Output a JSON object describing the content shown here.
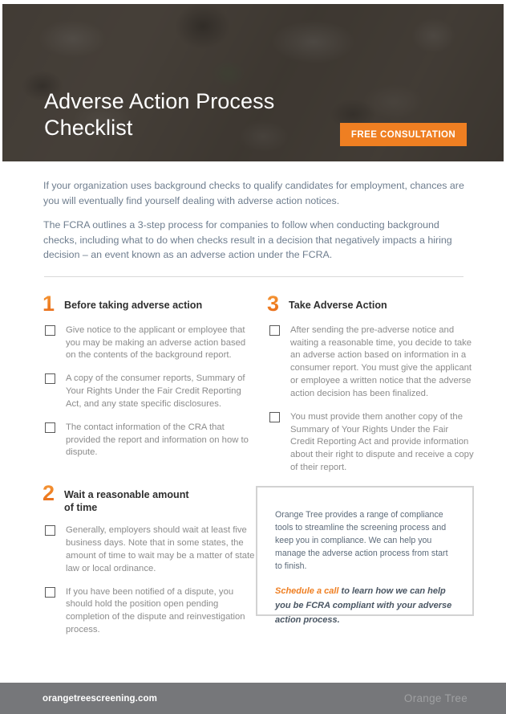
{
  "hero": {
    "title": "Adverse Action Process\nChecklist",
    "cta_label": "FREE CONSULTATION"
  },
  "intro": {
    "paragraph_1": "If your organization uses background checks to qualify candidates for employment, chances are you will eventually find yourself dealing with adverse action notices.",
    "paragraph_2": "The FCRA outlines a 3-step process for companies to follow when conducting background checks, including what to do when checks result in a decision that negatively impacts a hiring decision – an event known as an adverse action under the FCRA."
  },
  "sections": [
    {
      "number": "1",
      "title": "Before taking adverse action",
      "items": [
        "Give notice to the applicant or employee that you may be making an adverse action based on the contents of the background report.",
        "A copy of the consumer reports, Summary of Your Rights Under the Fair Credit Reporting Act, and any state specific disclosures.",
        "The contact information of the CRA that provided the report and information on how to dispute."
      ]
    },
    {
      "number": "2",
      "title": "Wait a reasonable amount\nof time",
      "items": [
        "Generally, employers should wait at least five business days. Note that in some states, the amount of time to wait may be a matter of state law or local ordinance.",
        "If you have been notified of a dispute, you should hold the position open pending completion of the dispute and reinvestigation process."
      ]
    },
    {
      "number": "3",
      "title": "Take Adverse Action",
      "items": [
        "After sending the pre-adverse notice and waiting a reasonable time, you decide to take an adverse action based on information in a consumer report. You must give the applicant or employee a written notice that the adverse action decision has been finalized.",
        "You must provide them another copy of the Summary of Your Rights Under the Fair Credit Reporting Act and provide information about their right to dispute and receive a copy of their report."
      ]
    }
  ],
  "callout": {
    "body": "Orange Tree provides a range of compliance tools to streamline the screening process and keep you in compliance. We can help you manage the adverse action process from start to finish.",
    "link_label": "Schedule a call",
    "cta_rest": " to learn how we can help you be FCRA compliant with your adverse action process."
  },
  "footer": {
    "url": "orangetreescreening.com",
    "brand": "Orange Tree"
  },
  "colors": {
    "orange": "#ef7f22",
    "footer_gray": "#76777a",
    "intro_text": "#6e7d8e",
    "item_text": "#8c8c8c",
    "border_gray": "#d2d2d2"
  }
}
